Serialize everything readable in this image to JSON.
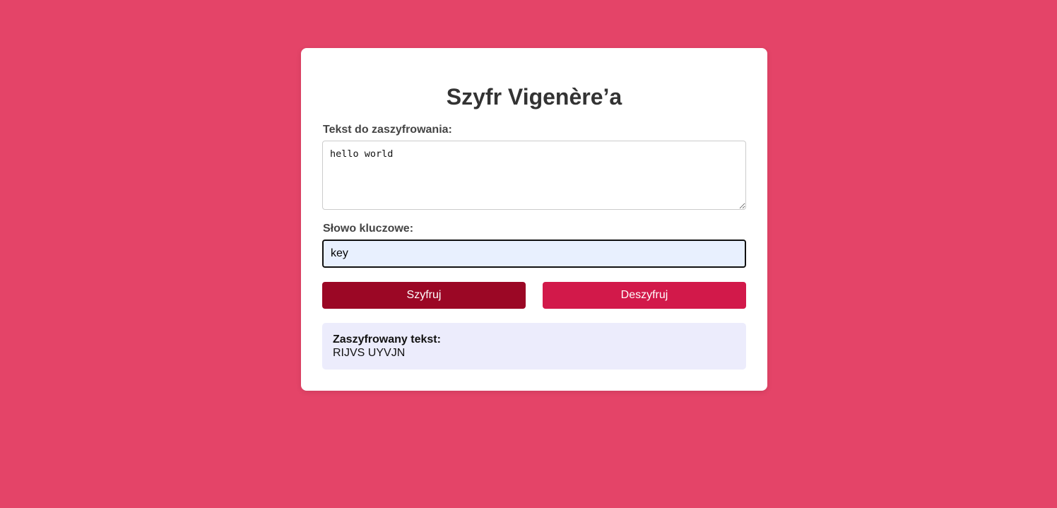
{
  "app": {
    "title": "Szyfr Vigenère’a"
  },
  "form": {
    "text_label": "Tekst do zaszyfrowania:",
    "text_value": "hello world",
    "key_label": "Słowo kluczowe:",
    "key_value": "key"
  },
  "buttons": {
    "encrypt_label": "Szyfruj",
    "decrypt_label": "Deszyfruj"
  },
  "result": {
    "label": "Zaszyfrowany tekst:",
    "value": "RIJVS UYVJN"
  },
  "colors": {
    "background": "#e44468",
    "encrypt_button": "#9b0725",
    "decrypt_button": "#d2194a",
    "result_background": "#ececfc"
  }
}
